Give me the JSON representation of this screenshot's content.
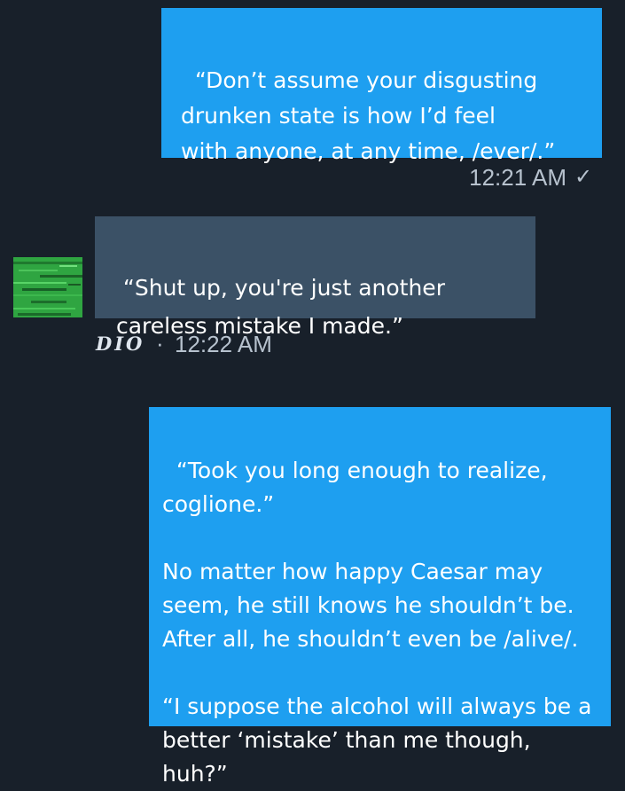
{
  "messages": [
    {
      "direction": "outgoing",
      "text": "“Don’t assume your disgusting\ndrunken state is how I’d feel\nwith anyone, at any time, /ever/.”",
      "time": "12:21 AM",
      "status_icon": "check-icon",
      "status_glyph": "✓"
    },
    {
      "direction": "incoming",
      "text": "“Shut up, you're just another\n careless mistake I made.”",
      "sender": "DIO",
      "separator": "·",
      "time": "12:22 AM",
      "avatar_icon": "green-texture-avatar"
    },
    {
      "direction": "outgoing",
      "text": "“Took you long enough to realize,\ncoglione.”\n\nNo matter how happy Caesar may\nseem, he still knows he shouldn’t be.\nAfter all, he shouldn’t even be /alive/.\n\n“I suppose the alcohol will always be a\nbetter ‘mistake’ than me though, huh?”"
    }
  ],
  "colors": {
    "background": "#18202a",
    "outgoing_bubble": "#1e9ff0",
    "incoming_bubble": "#3b5166",
    "meta_text": "#b7c2ce",
    "avatar_green": "#2fa541"
  }
}
